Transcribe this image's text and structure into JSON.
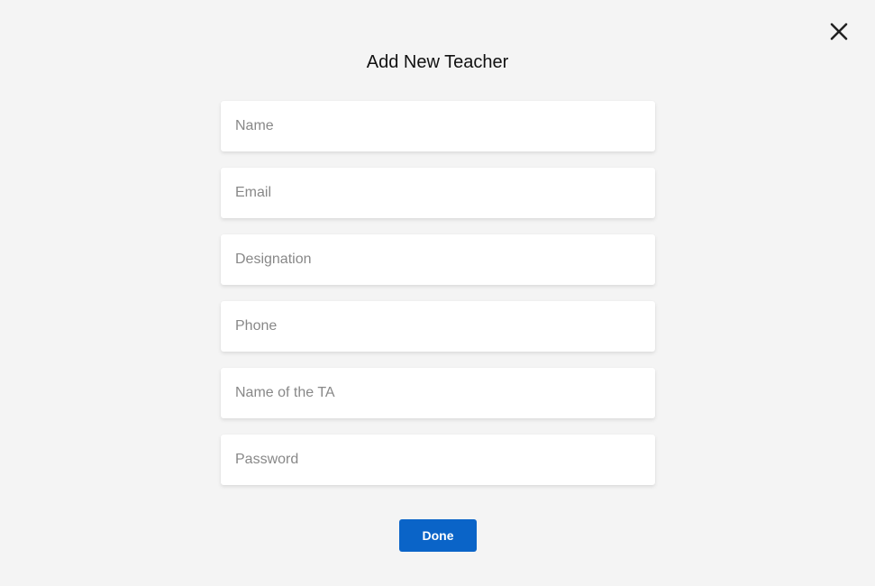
{
  "modal": {
    "title": "Add New Teacher",
    "close_icon": "close-icon"
  },
  "form": {
    "fields": [
      {
        "name": "name",
        "placeholder": "Name",
        "value": ""
      },
      {
        "name": "email",
        "placeholder": "Email",
        "value": ""
      },
      {
        "name": "designation",
        "placeholder": "Designation",
        "value": ""
      },
      {
        "name": "phone",
        "placeholder": "Phone",
        "value": ""
      },
      {
        "name": "ta-name",
        "placeholder": "Name of the TA",
        "value": ""
      },
      {
        "name": "password",
        "placeholder": "Password",
        "value": ""
      }
    ],
    "submit_label": "Done"
  },
  "colors": {
    "background": "#f4f4f4",
    "field_background": "#ffffff",
    "primary": "#0a64c8",
    "title_text": "#111111",
    "placeholder_text": "#888888"
  }
}
